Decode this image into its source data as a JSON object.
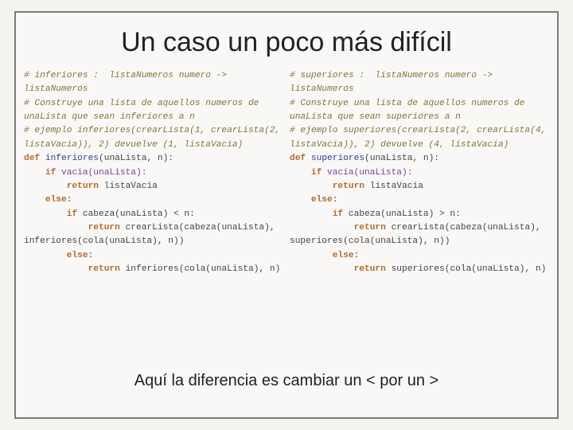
{
  "title": "Un caso un poco más difícil",
  "footer": "Aquí la diferencia es cambiar un < por un >",
  "left": {
    "comment1": "# inferiores :  listaNumeros numero -> listaNumeros",
    "comment2": "# Construye una lista de aquellos numeros de unaLista que sean inferiores a n",
    "comment3": "# ejemplo inferiores(crearLista(1, crearLista(2, listaVacia)), 2) devuelve (1, listaVacia)",
    "kw_def": "def",
    "fn_name": "inferiores",
    "def_params": "(unaLista, n):",
    "kw_if1": "if",
    "call_vacia": "vacia(unaLista):",
    "kw_ret1": "return",
    "ret_vacia": "listaVacia",
    "kw_else1": "else",
    "colon1": ":",
    "kw_if2": "if",
    "cond": "cabeza(unaLista) < n:",
    "kw_ret2": "return",
    "ret_crear": "crearLista(cabeza(unaLista), inferiores(cola(unaLista), n))",
    "kw_else2": "else",
    "colon2": ":",
    "kw_ret3": "return",
    "ret_rec": "inferiores(cola(unaLista), n)"
  },
  "right": {
    "comment1": "# superiores :  listaNumeros numero -> listaNumeros",
    "comment2": "# Construye una lista de aquellos numeros de unaLista que sean superiores a n",
    "comment3": "# ejemplo superiores(crearLista(2, crearLista(4, listaVacia)), 2) devuelve (4, listaVacia)",
    "kw_def": "def",
    "fn_name": "superiores",
    "def_params": "(unaLista, n):",
    "kw_if1": "if",
    "call_vacia": "vacia(unaLista):",
    "kw_ret1": "return",
    "ret_vacia": "listaVacia",
    "kw_else1": "else",
    "colon1": ":",
    "kw_if2": "if",
    "cond": "cabeza(unaLista) > n:",
    "kw_ret2": "return",
    "ret_crear": "crearLista(cabeza(unaLista), superiores(cola(unaLista), n))",
    "kw_else2": "else",
    "colon2": ":",
    "kw_ret3": "return",
    "ret_rec": "superiores(cola(unaLista), n)"
  }
}
